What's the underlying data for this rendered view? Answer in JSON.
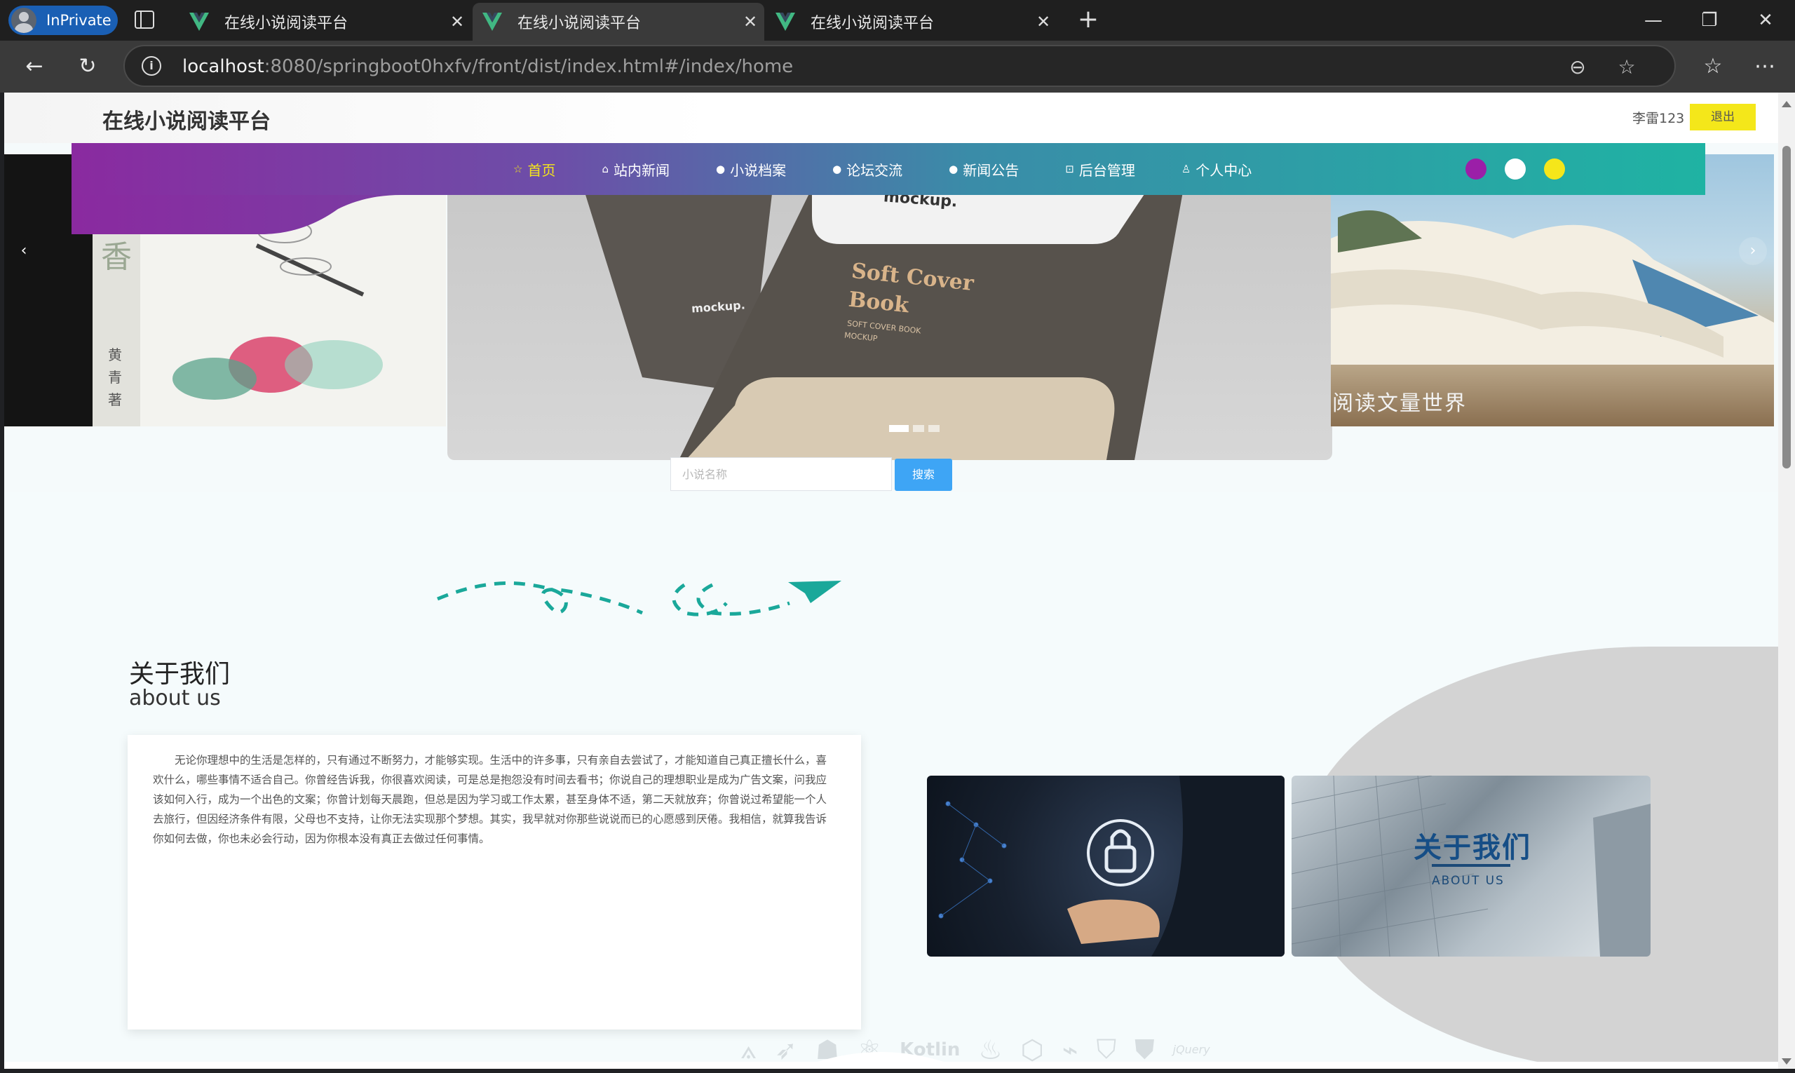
{
  "browser": {
    "inprivate_label": "InPrivate",
    "tabs": [
      {
        "title": "在线小说阅读平台",
        "active": false
      },
      {
        "title": "在线小说阅读平台",
        "active": true
      },
      {
        "title": "在线小说阅读平台",
        "active": false
      }
    ],
    "url_host": "localhost",
    "url_rest": ":8080/springboot0hxfv/front/dist/index.html#/index/home"
  },
  "header": {
    "site_title": "在线小说阅读平台",
    "user_name": "李雷123",
    "logout_label": "退出"
  },
  "nav": {
    "items": [
      {
        "icon": "☆",
        "label": "首页"
      },
      {
        "icon": "⌂",
        "label": "站内新闻"
      },
      {
        "icon": "●",
        "label": "小说档案"
      },
      {
        "icon": "●",
        "label": "论坛交流"
      },
      {
        "icon": "●",
        "label": "新闻公告"
      },
      {
        "icon": "⊡",
        "label": "后台管理"
      },
      {
        "icon": "♙",
        "label": "个人中心"
      }
    ],
    "active_index": 0,
    "theme_colors": [
      "#9b1fa8",
      "#ffffff",
      "#f5e61a"
    ]
  },
  "carousel": {
    "left_caption_chars": [
      "香",
      "黄",
      "青",
      "著"
    ],
    "center_texts": [
      "mockup.",
      "Soft Cover",
      "Book",
      "SOFT COVER BOOK",
      "MOCKUP",
      "mockup."
    ],
    "right_caption": "阅读文量世界",
    "prev_label": "‹",
    "next_label": "›",
    "slide_count": 3,
    "active_slide": 0
  },
  "search": {
    "placeholder": "小说名称",
    "button_label": "搜索"
  },
  "about": {
    "title": "关于我们",
    "subtitle": "about us",
    "body": "无论你理想中的生活是怎样的，只有通过不断努力，才能够实现。生活中的许多事，只有亲自去尝试了，才能知道自己真正擅长什么，喜欢什么，哪些事情不适合自己。你曾经告诉我，你很喜欢阅读，可是总是抱怨没有时间去看书；你说自己的理想职业是成为广告文案，问我应该如何入行，成为一个出色的文案；你曾计划每天晨跑，但总是因为学习或工作太累，甚至身体不适，第二天就放弃；你曾说过希望能一个人去旅行，但因经济条件有限，父母也不支持，让你无法实现那个梦想。其实，我早就对你那些说说而已的心愿感到厌倦。我相信，就算我告诉你如何去做，你也未必会行动，因为你根本没有真正去做过任何事情。",
    "image2_title": "关于我们",
    "image2_subtitle": "ABOUT US"
  },
  "logos": [
    "A",
    "swift",
    "android",
    "react",
    "Kotlin",
    "flame",
    "M",
    "js",
    "angular",
    "html5",
    "jQuery"
  ],
  "logos_text": {
    "kotlin": "Kotlin",
    "jquery": "jQuery"
  }
}
